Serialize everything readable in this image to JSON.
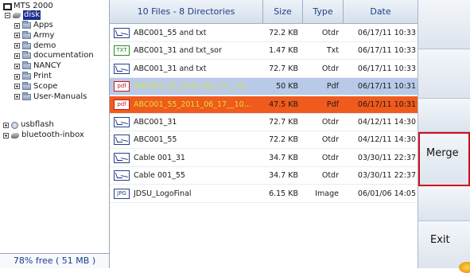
{
  "tree": {
    "root_label": "MTS 2000",
    "disk_label": "disk",
    "folders": [
      "Apps",
      "Army",
      "demo",
      "documentation",
      "NANCY",
      "Print",
      "Scope",
      "User-Manuals"
    ],
    "usb_label": "usbflash",
    "bt_label": "bluetooth-inbox",
    "free_status": "78% free (  51 MB )"
  },
  "table": {
    "header_summary": "10 Files - 8 Directories",
    "col_size": "Size",
    "col_type": "Type",
    "col_date": "Date",
    "rows": [
      {
        "icon": "otdr-file-icon",
        "name": "ABC001_55 and txt",
        "size": "72.2 KB",
        "type": "Otdr",
        "date": "06/17/11 10:33"
      },
      {
        "icon": "txt-file-icon",
        "icon_text": "TXT",
        "name": "ABC001_31 and txt_sor",
        "size": "1.47 KB",
        "type": "Txt",
        "date": "06/17/11 10:33"
      },
      {
        "icon": "otdr-file-icon",
        "name": "ABC001_31 and txt",
        "size": "72.7 KB",
        "type": "Otdr",
        "date": "06/17/11 10:33"
      },
      {
        "icon": "pdf-file-icon",
        "icon_text": "pdf",
        "name": "ABC001_31_2011_06_17__10...",
        "size": "50 KB",
        "type": "Pdf",
        "date": "06/17/11 10:31"
      },
      {
        "icon": "pdf-file-icon",
        "icon_text": "pdf",
        "name": "ABC001_55_2011_06_17__10...",
        "size": "47.5 KB",
        "type": "Pdf",
        "date": "06/17/11 10:31"
      },
      {
        "icon": "otdr-file-icon",
        "name": "ABC001_31",
        "size": "72.7 KB",
        "type": "Otdr",
        "date": "04/12/11 14:30"
      },
      {
        "icon": "otdr-file-icon",
        "name": "ABC001_55",
        "size": "72.2 KB",
        "type": "Otdr",
        "date": "04/12/11 14:30"
      },
      {
        "icon": "otdr-file-icon",
        "name": "Cable 001_31",
        "size": "34.7 KB",
        "type": "Otdr",
        "date": "03/30/11 22:37"
      },
      {
        "icon": "otdr-file-icon",
        "name": "Cable 001_55",
        "size": "34.7 KB",
        "type": "Otdr",
        "date": "03/30/11 22:37"
      },
      {
        "icon": "jpg-file-icon",
        "icon_text": "JPG",
        "name": "JDSU_LogoFinal",
        "size": "6.15 KB",
        "type": "Image",
        "date": "06/01/06 14:05"
      }
    ]
  },
  "side": {
    "merge_label": "Merge",
    "exit_label": "Exit"
  },
  "colors": {
    "selection_light": "#b9c9e8",
    "selection_orange": "#f05a1c",
    "merge_highlight": "#d0101e"
  }
}
